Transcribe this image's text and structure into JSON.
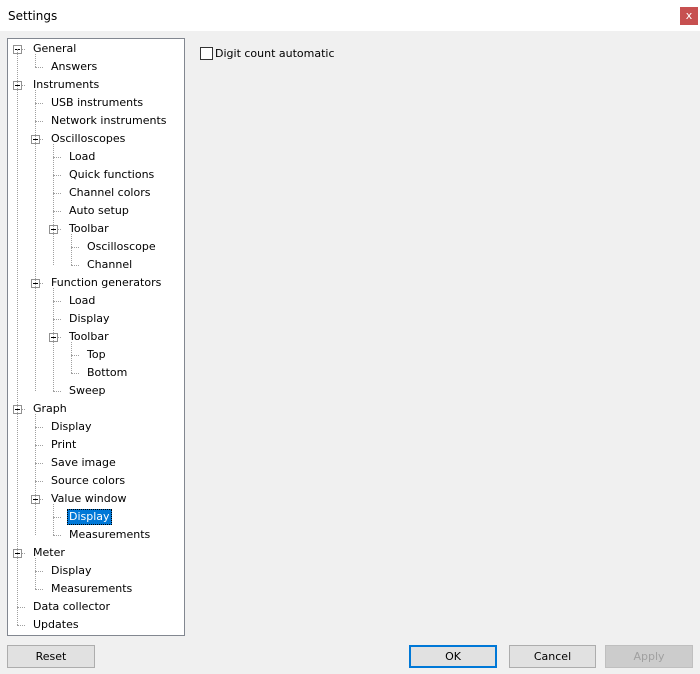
{
  "window": {
    "title": "Settings",
    "close_label": "x"
  },
  "tree": [
    {
      "label": "General",
      "expanded": true,
      "children": [
        {
          "label": "Answers"
        }
      ]
    },
    {
      "label": "Instruments",
      "expanded": true,
      "children": [
        {
          "label": "USB instruments"
        },
        {
          "label": "Network instruments"
        },
        {
          "label": "Oscilloscopes",
          "expanded": true,
          "children": [
            {
              "label": "Load"
            },
            {
              "label": "Quick functions"
            },
            {
              "label": "Channel colors"
            },
            {
              "label": "Auto setup"
            },
            {
              "label": "Toolbar",
              "expanded": true,
              "children": [
                {
                  "label": "Oscilloscope"
                },
                {
                  "label": "Channel"
                }
              ]
            }
          ]
        },
        {
          "label": "Function generators",
          "expanded": true,
          "children": [
            {
              "label": "Load"
            },
            {
              "label": "Display"
            },
            {
              "label": "Toolbar",
              "expanded": true,
              "children": [
                {
                  "label": "Top"
                },
                {
                  "label": "Bottom"
                }
              ]
            },
            {
              "label": "Sweep"
            }
          ]
        }
      ]
    },
    {
      "label": "Graph",
      "expanded": true,
      "children": [
        {
          "label": "Display"
        },
        {
          "label": "Print"
        },
        {
          "label": "Save image"
        },
        {
          "label": "Source colors"
        },
        {
          "label": "Value window",
          "expanded": true,
          "children": [
            {
              "label": "Display",
              "selected": true
            },
            {
              "label": "Measurements"
            }
          ]
        }
      ]
    },
    {
      "label": "Meter",
      "expanded": true,
      "children": [
        {
          "label": "Display"
        },
        {
          "label": "Measurements"
        }
      ]
    },
    {
      "label": "Data collector"
    },
    {
      "label": "Updates"
    }
  ],
  "panel": {
    "checkbox_label": "Digit count automatic",
    "checkbox_checked": false
  },
  "buttons": {
    "reset": "Reset",
    "ok": "OK",
    "cancel": "Cancel",
    "apply": "Apply"
  },
  "colors": {
    "selection": "#0078d7",
    "close": "#c75050"
  }
}
